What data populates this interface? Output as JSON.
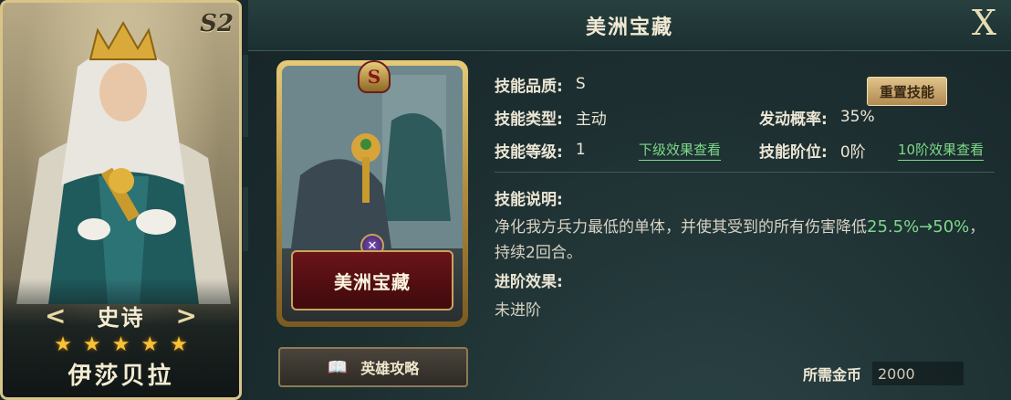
{
  "hero": {
    "season": "S2",
    "rarity": "史诗",
    "stars": 5,
    "name": "伊莎贝拉",
    "prev_arrow": "<",
    "next_arrow": ">"
  },
  "panel": {
    "title": "美洲宝藏",
    "close_label": "X"
  },
  "skill_card": {
    "grade_badge": "S",
    "name": "美洲宝藏",
    "type_icon": "crossed-swords-icon"
  },
  "guide_button": {
    "icon": "book-icon",
    "label": "英雄攻略"
  },
  "info": {
    "quality_label": "技能品质:",
    "quality_value": "S",
    "type_label": "技能类型:",
    "type_value": "主动",
    "trigger_label": "发动概率:",
    "trigger_value": "35%",
    "level_label": "技能等级:",
    "level_value": "1",
    "next_level_link": "下级效果查看",
    "tier_label": "技能阶位:",
    "tier_value": "0阶",
    "tier10_link": "10阶效果查看",
    "reset_button": "重置技能"
  },
  "description": {
    "header": "技能说明:",
    "text_a": "净化我方兵力最低的单体，并使其受到的所有伤害降低",
    "highlight": "25.5%→50%",
    "text_b": "，持续2回合。"
  },
  "advance": {
    "header": "进阶效果:",
    "body": "未进阶"
  },
  "cost": {
    "label": "所需金币",
    "value": "2000"
  },
  "colors": {
    "highlight_green": "#7ed98a",
    "gold_frame": "#c9a45a",
    "star": "#f6c23a"
  }
}
